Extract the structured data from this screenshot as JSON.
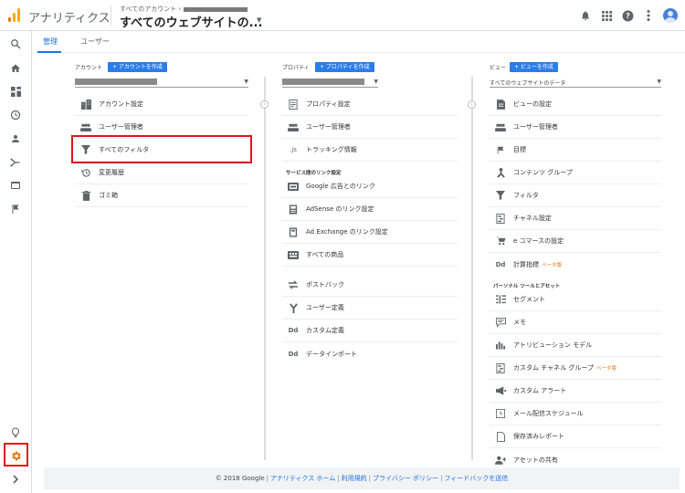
{
  "header": {
    "app_title": "アナリティクス",
    "account_crumb": "すべてのアカウント ›",
    "property_name": "すべてのウェブサイトの..."
  },
  "tabs": [
    {
      "label": "管理",
      "active": true
    },
    {
      "label": "ユーザー",
      "active": false
    }
  ],
  "account": {
    "heading": "アカウント",
    "create_label": "+ アカウントを作成",
    "items": [
      {
        "icon": "building-icon",
        "label": "アカウント設定"
      },
      {
        "icon": "people-icon",
        "label": "ユーザー管理者"
      },
      {
        "icon": "filter-icon",
        "label": "すべてのフィルタ"
      },
      {
        "icon": "history-icon",
        "label": "変更履歴"
      },
      {
        "icon": "trash-icon",
        "label": "ゴミ箱"
      }
    ]
  },
  "property": {
    "heading": "プロパティ",
    "create_label": "+ プロパティを作成",
    "items_top": [
      {
        "icon": "document-icon",
        "label": "プロパティ設定"
      },
      {
        "icon": "people-icon",
        "label": "ユーザー管理者"
      },
      {
        "icon": "js-icon",
        "icon_text": ".js",
        "label": "トラッキング情報"
      }
    ],
    "section_label": "サービス間のリンク設定",
    "items_links": [
      {
        "icon": "google-ads-icon",
        "label": "Google 広告とのリンク"
      },
      {
        "icon": "adsense-icon",
        "label": "AdSense のリンク設定"
      },
      {
        "icon": "ad-exchange-icon",
        "label": "Ad Exchange のリンク設定"
      },
      {
        "icon": "products-icon",
        "label": "すべての商品"
      }
    ],
    "items_bottom": [
      {
        "icon": "postback-icon",
        "label": "ポストバック"
      },
      {
        "icon": "custom-dimension-icon",
        "label": "ユーザー定義"
      },
      {
        "icon": "dd-icon",
        "icon_text": "Dd",
        "label": "カスタム定義"
      },
      {
        "icon": "dd-icon",
        "icon_text": "Dd",
        "label": "データインポート"
      }
    ]
  },
  "view": {
    "heading": "ビュー",
    "create_label": "+ ビューを作成",
    "selected": "すべてのウェブサイトのデータ",
    "items_top": [
      {
        "icon": "document-icon",
        "label": "ビューの設定"
      },
      {
        "icon": "people-icon",
        "label": "ユーザー管理者"
      },
      {
        "icon": "flag-icon",
        "label": "目標"
      },
      {
        "icon": "content-group-icon",
        "label": "コンテンツ グループ"
      },
      {
        "icon": "filter-icon",
        "label": "フィルタ"
      },
      {
        "icon": "channel-icon",
        "label": "チャネル設定"
      },
      {
        "icon": "cart-icon",
        "label": "e コマースの設定"
      },
      {
        "icon": "dd-icon",
        "icon_text": "Dd",
        "label": "計算指標",
        "beta": "ベータ版"
      }
    ],
    "section_label": "パーソナル ツールとアセット",
    "items_personal": [
      {
        "icon": "segment-icon",
        "label": "セグメント"
      },
      {
        "icon": "memo-icon",
        "label": "メモ"
      },
      {
        "icon": "attribution-icon",
        "label": "アトリビューション モデル"
      },
      {
        "icon": "channel-icon",
        "label": "カスタム チャネル グループ",
        "beta": "ベータ版"
      },
      {
        "icon": "megaphone-icon",
        "label": "カスタム アラート"
      },
      {
        "icon": "clock-icon",
        "label": "メール配信スケジュール"
      },
      {
        "icon": "saved-report-icon",
        "label": "保存済みレポート"
      },
      {
        "icon": "share-assets-icon",
        "label": "アセットの共有"
      }
    ]
  },
  "footer": {
    "copyright": "© 2018 Google",
    "links": [
      "アナリティクス ホーム",
      "利用規約",
      "プライバシー ポリシー",
      "フィードバックを送信"
    ]
  },
  "colors": {
    "accent": "#1a73e8",
    "button": "#2b7de9",
    "highlight": "#e0141e",
    "beta": "#e8710a"
  }
}
